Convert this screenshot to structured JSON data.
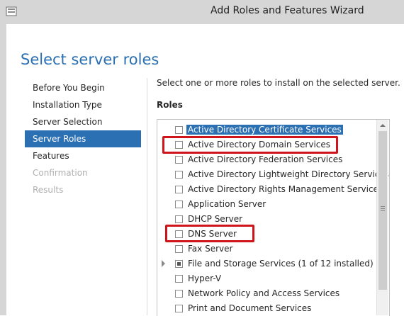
{
  "window": {
    "title": "Add Roles and Features Wizard",
    "icon": "server-manager-icon"
  },
  "page": {
    "title": "Select server roles"
  },
  "nav": {
    "items": [
      {
        "label": "Before You Begin",
        "state": "normal"
      },
      {
        "label": "Installation Type",
        "state": "normal"
      },
      {
        "label": "Server Selection",
        "state": "normal"
      },
      {
        "label": "Server Roles",
        "state": "active"
      },
      {
        "label": "Features",
        "state": "normal"
      },
      {
        "label": "Confirmation",
        "state": "disabled"
      },
      {
        "label": "Results",
        "state": "disabled"
      }
    ]
  },
  "content": {
    "instruction": "Select one or more roles to install on the selected server.",
    "roles_label": "Roles"
  },
  "roles": [
    {
      "label": "Active Directory Certificate Services",
      "checked": false,
      "selected": true
    },
    {
      "label": "Active Directory Domain Services",
      "checked": false,
      "highlighted": true
    },
    {
      "label": "Active Directory Federation Services",
      "checked": false
    },
    {
      "label": "Active Directory Lightweight Directory Services",
      "checked": false
    },
    {
      "label": "Active Directory Rights Management Services",
      "checked": false
    },
    {
      "label": "Application Server",
      "checked": false
    },
    {
      "label": "DHCP Server",
      "checked": false
    },
    {
      "label": "DNS Server",
      "checked": false,
      "highlighted": true
    },
    {
      "label": "Fax Server",
      "checked": false
    },
    {
      "label": "File and Storage Services (1 of 12 installed)",
      "checked": "partial",
      "expandable": true
    },
    {
      "label": "Hyper-V",
      "checked": false
    },
    {
      "label": "Network Policy and Access Services",
      "checked": false
    },
    {
      "label": "Print and Document Services",
      "checked": false
    }
  ],
  "colors": {
    "accent": "#2c70b4",
    "annotation": "#d0141b",
    "title_text": "#2b6fb3"
  }
}
